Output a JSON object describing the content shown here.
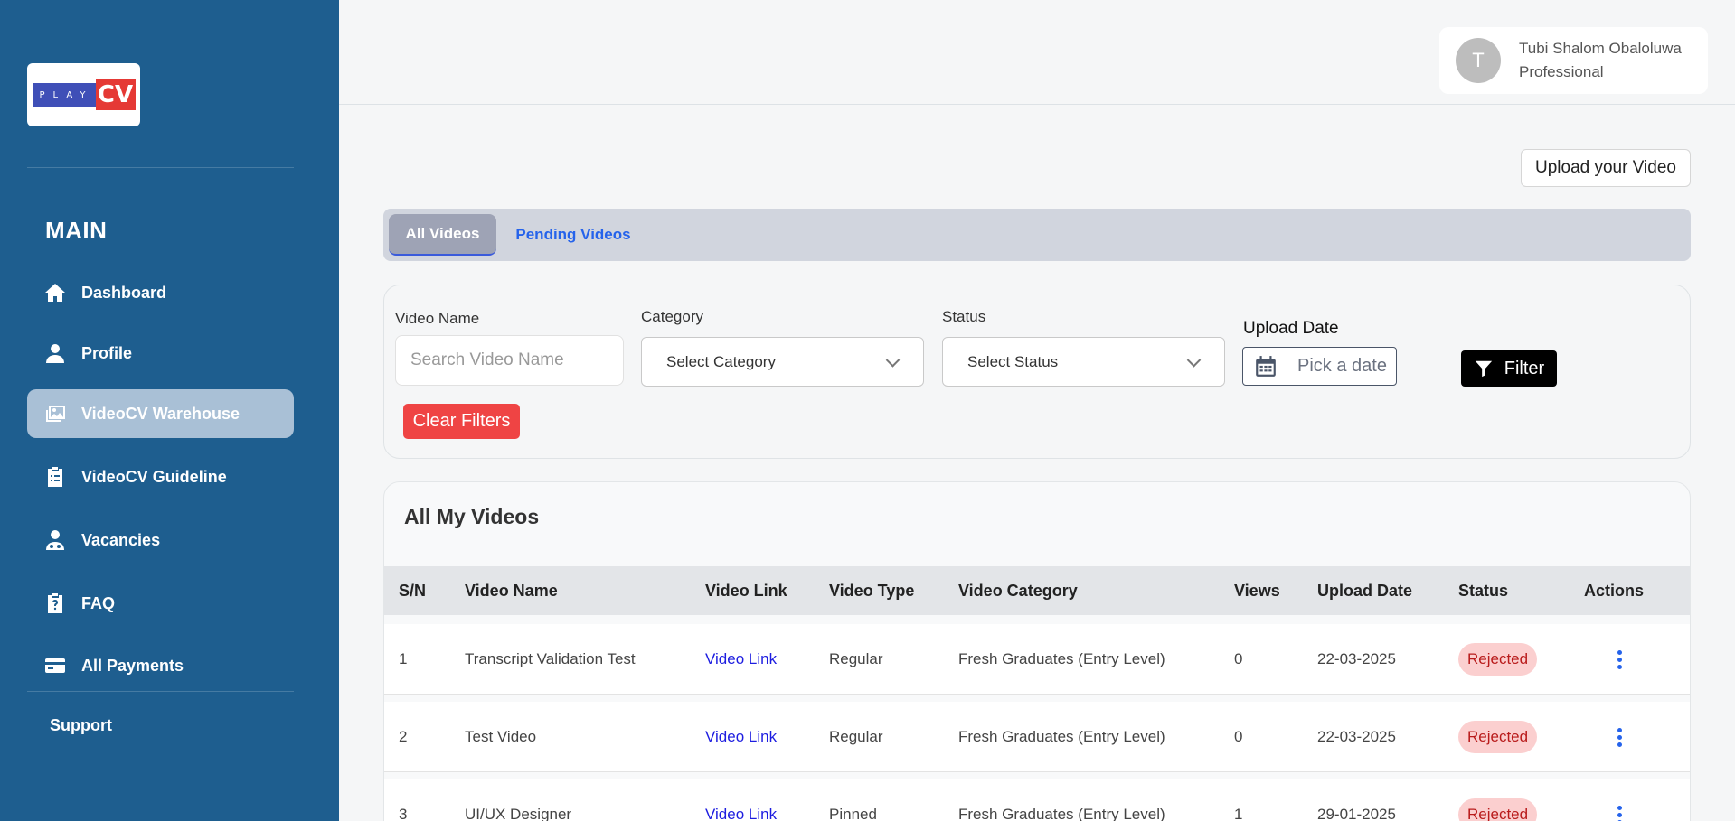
{
  "sidebar": {
    "logo_left": "PLAY",
    "logo_right": "CV",
    "section_title": "MAIN",
    "items": [
      {
        "label": "Dashboard",
        "icon": "home-icon"
      },
      {
        "label": "Profile",
        "icon": "user-icon"
      },
      {
        "label": "VideoCV Warehouse",
        "icon": "images-icon",
        "active": true
      },
      {
        "label": "VideoCV Guideline",
        "icon": "clipboard-icon"
      },
      {
        "label": "Vacancies",
        "icon": "doctor-icon"
      },
      {
        "label": "FAQ",
        "icon": "clipboard-question-icon"
      },
      {
        "label": "All Payments",
        "icon": "credit-card-icon"
      }
    ],
    "support": "Support"
  },
  "header": {
    "avatar_initial": "T",
    "user_name": "Tubi Shalom Obaloluwa",
    "user_role": "Professional"
  },
  "actions": {
    "upload": "Upload your Video"
  },
  "tabs": [
    {
      "label": "All Videos",
      "active": true
    },
    {
      "label": "Pending Videos",
      "active": false
    }
  ],
  "filters": {
    "video_name_label": "Video Name",
    "video_name_placeholder": "Search Video Name",
    "category_label": "Category",
    "category_value": "Select Category",
    "status_label": "Status",
    "status_value": "Select Status",
    "upload_date_label": "Upload Date",
    "upload_date_placeholder": "Pick a date",
    "filter_button": "Filter",
    "clear_button": "Clear Filters"
  },
  "table": {
    "title": "All My Videos",
    "columns": [
      "S/N",
      "Video Name",
      "Video Link",
      "Video Type",
      "Video Category",
      "Views",
      "Upload Date",
      "Status",
      "Actions"
    ],
    "rows": [
      {
        "sn": "1",
        "name": "Transcript Validation Test",
        "link": "Video Link",
        "type": "Regular",
        "category": "Fresh Graduates (Entry Level)",
        "views": "0",
        "date": "22-03-2025",
        "status": "Rejected"
      },
      {
        "sn": "2",
        "name": "Test Video",
        "link": "Video Link",
        "type": "Regular",
        "category": "Fresh Graduates (Entry Level)",
        "views": "0",
        "date": "22-03-2025",
        "status": "Rejected"
      },
      {
        "sn": "3",
        "name": "UI/UX Designer",
        "link": "Video Link",
        "type": "Pinned",
        "category": "Fresh Graduates (Entry Level)",
        "views": "1",
        "date": "29-01-2025",
        "status": "Rejected"
      }
    ]
  },
  "colors": {
    "sidebar_bg": "#1e5e8f",
    "active_nav_bg": "#a9c0d6",
    "rejected_badge_bg": "#fbcfcf",
    "link_blue": "#1d1de0",
    "clear_red": "#ef4444"
  }
}
